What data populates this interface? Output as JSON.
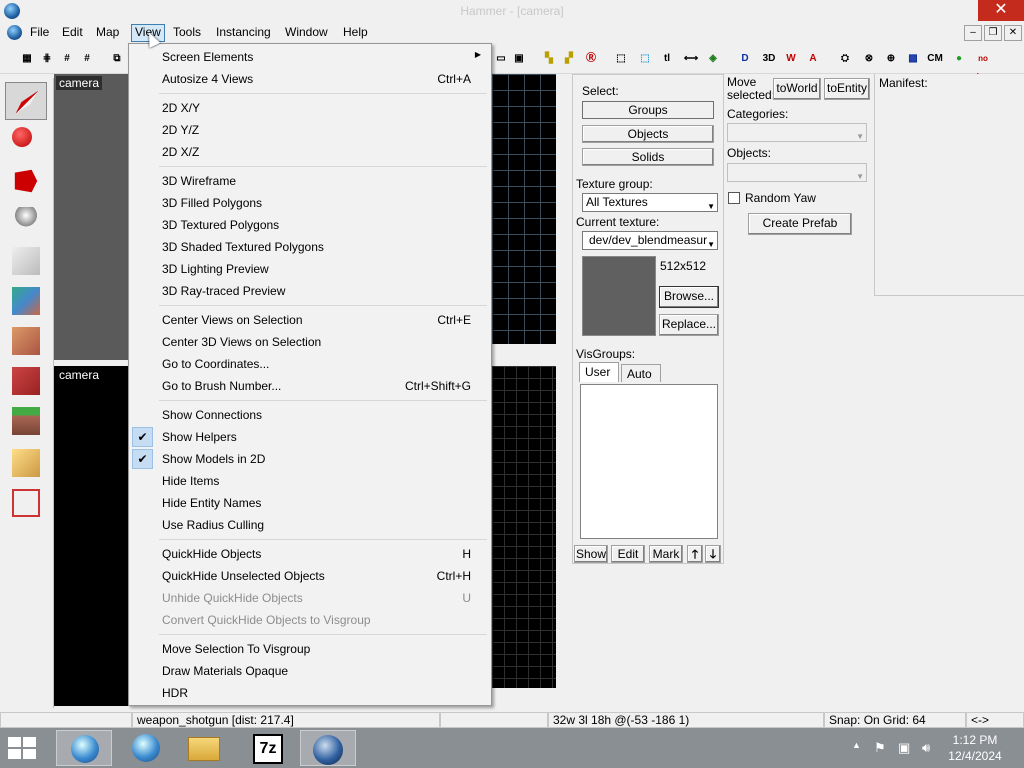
{
  "window": {
    "title": "Hammer - [camera]"
  },
  "menubar": {
    "items": [
      "File",
      "Edit",
      "Map",
      "View",
      "Tools",
      "Instancing",
      "Window",
      "Help"
    ],
    "active": "View"
  },
  "view_menu": {
    "items": [
      {
        "label": "Screen Elements",
        "shortcut": "",
        "submenu": true
      },
      {
        "label": "Autosize 4 Views",
        "shortcut": "Ctrl+A"
      },
      {
        "label": "2D X/Y",
        "shortcut": ""
      },
      {
        "label": "2D Y/Z",
        "shortcut": ""
      },
      {
        "label": "2D X/Z",
        "shortcut": ""
      },
      {
        "label": "3D Wireframe",
        "shortcut": ""
      },
      {
        "label": "3D Filled Polygons",
        "shortcut": ""
      },
      {
        "label": "3D Textured Polygons",
        "shortcut": ""
      },
      {
        "label": "3D Shaded Textured Polygons",
        "shortcut": ""
      },
      {
        "label": "3D Lighting Preview",
        "shortcut": ""
      },
      {
        "label": "3D Ray-traced Preview",
        "shortcut": ""
      },
      {
        "label": "Center Views on Selection",
        "shortcut": "Ctrl+E"
      },
      {
        "label": "Center 3D Views on Selection",
        "shortcut": ""
      },
      {
        "label": "Go to Coordinates...",
        "shortcut": ""
      },
      {
        "label": "Go to Brush Number...",
        "shortcut": "Ctrl+Shift+G"
      },
      {
        "label": "Show Connections",
        "shortcut": ""
      },
      {
        "label": "Show Helpers",
        "shortcut": "",
        "checked": true
      },
      {
        "label": "Show Models in 2D",
        "shortcut": "",
        "checked": true
      },
      {
        "label": "Hide Items",
        "shortcut": ""
      },
      {
        "label": "Hide Entity Names",
        "shortcut": ""
      },
      {
        "label": "Use Radius Culling",
        "shortcut": ""
      },
      {
        "label": "QuickHide Objects",
        "shortcut": "H"
      },
      {
        "label": "QuickHide Unselected Objects",
        "shortcut": "Ctrl+H"
      },
      {
        "label": "Unhide QuickHide Objects",
        "shortcut": "U",
        "disabled": true
      },
      {
        "label": "Convert QuickHide Objects to Visgroup",
        "shortcut": "",
        "disabled": true
      },
      {
        "label": "Move Selection To Visgroup",
        "shortcut": ""
      },
      {
        "label": "Draw Materials Opaque",
        "shortcut": ""
      },
      {
        "label": "HDR",
        "shortcut": ""
      }
    ]
  },
  "viewports": {
    "top_left_label": "camera",
    "bottom_left_label": "camera"
  },
  "select_panel": {
    "label": "Select:",
    "buttons": [
      "Groups",
      "Objects",
      "Solids"
    ],
    "texture_group_label": "Texture group:",
    "texture_group_value": "All Textures",
    "current_texture_label": "Current texture:",
    "current_texture_value": "dev/dev_blendmeasure",
    "texture_size": "512x512",
    "browse_label": "Browse...",
    "replace_label": "Replace...",
    "visgroups_label": "VisGroups:",
    "tabs": [
      "User",
      "Auto"
    ],
    "bottom_buttons": [
      "Show",
      "Edit",
      "Mark"
    ]
  },
  "move_panel": {
    "move_label": "Move selected:",
    "to_world": "toWorld",
    "to_entity": "toEntity",
    "categories_label": "Categories:",
    "objects_label": "Objects:",
    "random_yaw_label": "Random Yaw",
    "create_prefab_label": "Create Prefab"
  },
  "manifest": {
    "label": "Manifest:"
  },
  "statusbar": {
    "selection": "weapon_shotgun   [dist: 217.4]",
    "coords": "32w 3l 18h @(-53 -186 1)",
    "snap": "Snap: On Grid: 64",
    "arrows": "<->"
  },
  "taskbar": {
    "time": "1:12 PM",
    "date": "12/4/2024"
  },
  "colors": {
    "close_button": "#c42b1c",
    "taskbar": "#8a8f94",
    "menu_highlight": "#d5e8f7"
  }
}
